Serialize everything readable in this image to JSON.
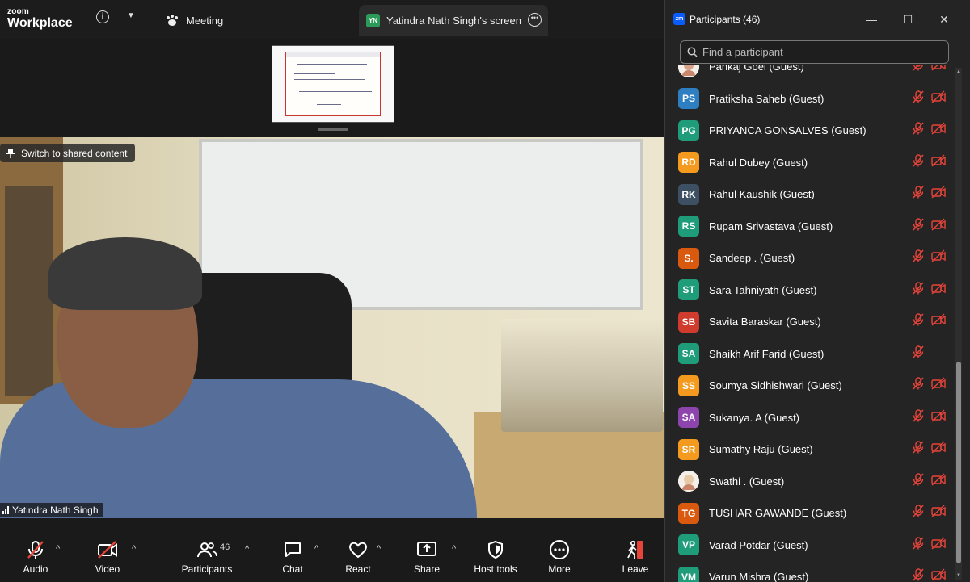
{
  "app": {
    "logo_line1": "zoom",
    "logo_line2": "Workplace"
  },
  "topbar": {
    "meeting_label": "Meeting",
    "share_tab": {
      "initials": "YN",
      "label": "Yatindra Nath Singh's screen"
    }
  },
  "video": {
    "switch_label": "Switch to shared content",
    "speaker_name": "Yatindra Nath Singh"
  },
  "toolbar": {
    "audio": "Audio",
    "video": "Video",
    "participants": "Participants",
    "participants_count": "46",
    "chat": "Chat",
    "react": "React",
    "share": "Share",
    "host_tools": "Host tools",
    "more": "More",
    "leave": "Leave"
  },
  "panel": {
    "title": "Participants (46)",
    "search_placeholder": "Find a participant",
    "participants": [
      {
        "initials": "",
        "name": "Pankaj Goel (Guest)",
        "color": "#d9a08a",
        "photo": true,
        "cam_off": true
      },
      {
        "initials": "PS",
        "name": "Pratiksha Saheb (Guest)",
        "color": "#2d7fc1",
        "photo": false,
        "cam_off": true
      },
      {
        "initials": "PG",
        "name": "PRIYANCA GONSALVES (Guest)",
        "color": "#1f9d7a",
        "photo": false,
        "cam_off": true
      },
      {
        "initials": "RD",
        "name": "Rahul Dubey (Guest)",
        "color": "#f39a1f",
        "photo": false,
        "cam_off": true
      },
      {
        "initials": "RK",
        "name": "Rahul Kaushik (Guest)",
        "color": "#3d4f63",
        "photo": false,
        "cam_off": true
      },
      {
        "initials": "RS",
        "name": "Rupam Srivastava (Guest)",
        "color": "#1f9d7a",
        "photo": false,
        "cam_off": true
      },
      {
        "initials": "S.",
        "name": "Sandeep . (Guest)",
        "color": "#d9590f",
        "photo": false,
        "cam_off": true
      },
      {
        "initials": "ST",
        "name": "Sara Tahniyath (Guest)",
        "color": "#1f9d7a",
        "photo": false,
        "cam_off": true
      },
      {
        "initials": "SB",
        "name": "Savita Baraskar (Guest)",
        "color": "#cf3b2c",
        "photo": false,
        "cam_off": true
      },
      {
        "initials": "SA",
        "name": "Shaikh Arif Farid (Guest)",
        "color": "#1f9d7a",
        "photo": false,
        "cam_off": false
      },
      {
        "initials": "SS",
        "name": "Soumya Sidhishwari (Guest)",
        "color": "#f39a1f",
        "photo": false,
        "cam_off": true
      },
      {
        "initials": "SA",
        "name": "Sukanya. A (Guest)",
        "color": "#8e44ad",
        "photo": false,
        "cam_off": true
      },
      {
        "initials": "SR",
        "name": "Sumathy Raju (Guest)",
        "color": "#f39a1f",
        "photo": false,
        "cam_off": true
      },
      {
        "initials": "",
        "name": "Swathi . (Guest)",
        "color": "#e8c9a8",
        "photo": true,
        "cam_off": true
      },
      {
        "initials": "TG",
        "name": "TUSHAR GAWANDE (Guest)",
        "color": "#d9590f",
        "photo": false,
        "cam_off": true
      },
      {
        "initials": "VP",
        "name": "Varad Potdar (Guest)",
        "color": "#1f9d7a",
        "photo": false,
        "cam_off": true
      },
      {
        "initials": "VM",
        "name": "Varun Mishra (Guest)",
        "color": "#1f9d7a",
        "photo": false,
        "cam_off": true
      }
    ]
  },
  "colors": {
    "accent_red": "#e8443a",
    "panel_bg": "#242424",
    "toolbar_bg": "#1a1a1a"
  }
}
